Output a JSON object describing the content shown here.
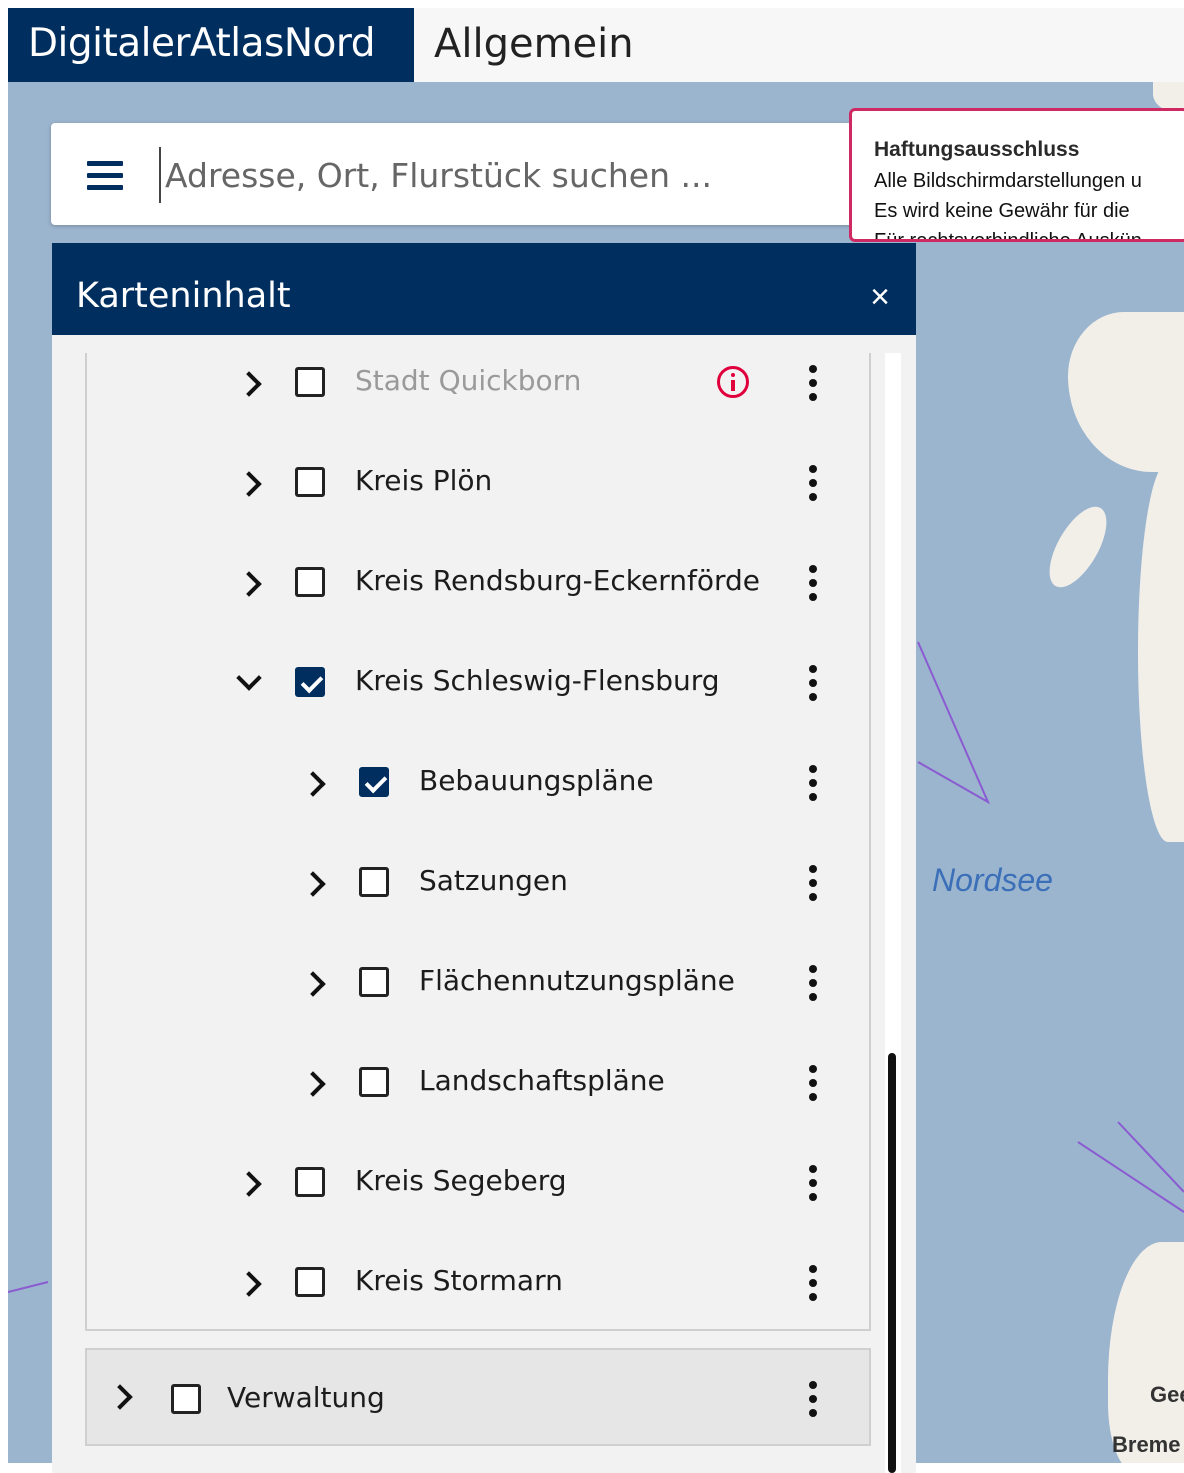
{
  "header": {
    "brand": "DigitalerAtlasNord",
    "topic": "Allgemein"
  },
  "search": {
    "placeholder": "Adresse, Ort, Flurstück suchen ..."
  },
  "disclaimer": {
    "title": "Haftungsausschluss",
    "line1": "Alle Bildschirmdarstellungen u",
    "line2": "Es wird keine Gewähr für die",
    "line3": "Für rechtsverbindliche Auskün"
  },
  "panel": {
    "title": "Karteninhalt",
    "close": "×"
  },
  "tree": {
    "items": [
      {
        "label": "Stadt Quickborn",
        "checked": false,
        "expanded": false,
        "muted": true,
        "info": true
      },
      {
        "label": "Kreis Plön",
        "checked": false,
        "expanded": false
      },
      {
        "label": "Kreis Rendsburg-Eckernförde",
        "checked": false,
        "expanded": false
      },
      {
        "label": "Kreis Schleswig-Flensburg",
        "checked": true,
        "expanded": true
      },
      {
        "label": "Bebauungspläne",
        "checked": true,
        "expanded": false,
        "child": true
      },
      {
        "label": "Satzungen",
        "checked": false,
        "expanded": false,
        "child": true
      },
      {
        "label": "Flächennutzungspläne",
        "checked": false,
        "expanded": false,
        "child": true
      },
      {
        "label": "Landschaftspläne",
        "checked": false,
        "expanded": false,
        "child": true
      },
      {
        "label": "Kreis Segeberg",
        "checked": false,
        "expanded": false
      },
      {
        "label": "Kreis Stormarn",
        "checked": false,
        "expanded": false
      }
    ],
    "verwaltung": {
      "label": "Verwaltung",
      "checked": false
    }
  },
  "map": {
    "sea_label": "Nordsee",
    "place1": "Gee",
    "place2": "Breme"
  }
}
